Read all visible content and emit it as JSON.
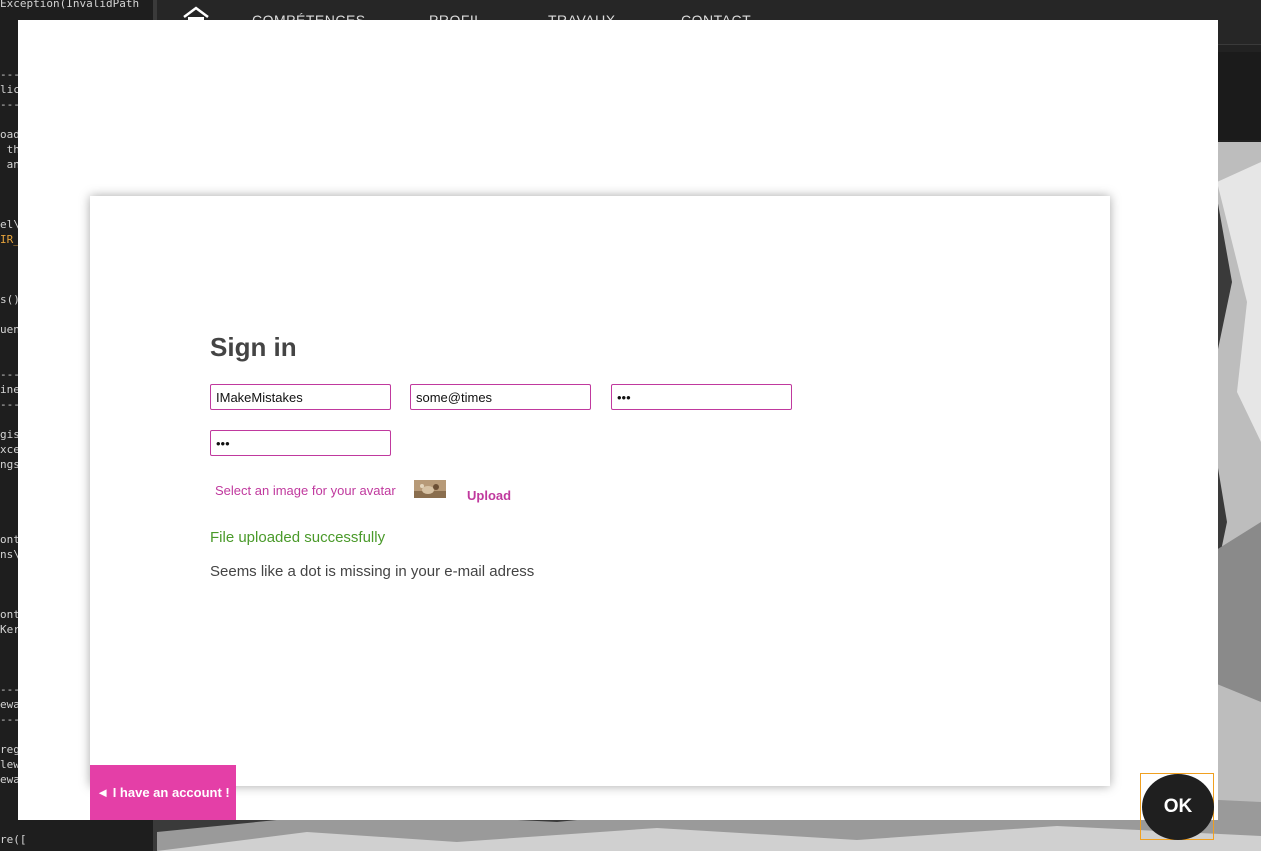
{
  "background": {
    "code_lines": [
      {
        "text": "Exception(InvalidPath"
      },
      {
        "text": "---"
      },
      {
        "text": "lic"
      },
      {
        "text": "---"
      },
      {
        "text": "oad"
      },
      {
        "text": " th"
      },
      {
        "text": " an"
      },
      {
        "text": "el\\"
      },
      {
        "text": "IR_",
        "highlight": true
      },
      {
        "text": "s()"
      },
      {
        "text": "uen"
      },
      {
        "text": "---"
      },
      {
        "text": "ine"
      },
      {
        "text": "---"
      },
      {
        "text": "gis"
      },
      {
        "text": "xce"
      },
      {
        "text": "ngs"
      },
      {
        "text": "ont"
      },
      {
        "text": "ns\\"
      },
      {
        "text": "ont"
      },
      {
        "text": "Ker"
      },
      {
        "text": "---"
      },
      {
        "text": "ewa"
      },
      {
        "text": "---"
      },
      {
        "text": "reg"
      },
      {
        "text": "lew"
      },
      {
        "text": "ewa"
      },
      {
        "text": "re(["
      }
    ],
    "nav": {
      "links": [
        "COMPÉTENCES",
        "PROFIL",
        "TRAVAUX",
        "CONTACT"
      ]
    }
  },
  "form": {
    "title": "Sign in",
    "username_value": "IMakeMistakes",
    "email_value": "some@times",
    "password_value": "•••",
    "password_confirm_value": "•••",
    "avatar_label": "Select an image for your avatar",
    "upload_label": "Upload",
    "success_message": "File uploaded successfully",
    "error_message": "Seems like a dot is missing in your e-mail adress",
    "ok_label": "OK",
    "account_label": "◄ I have an account !"
  },
  "colors": {
    "accent": "#e43fa7",
    "field_border": "#c0399e",
    "success": "#4a9a2a",
    "ok_button": "#1f1f1f",
    "focus_outline": "#f0a020"
  }
}
